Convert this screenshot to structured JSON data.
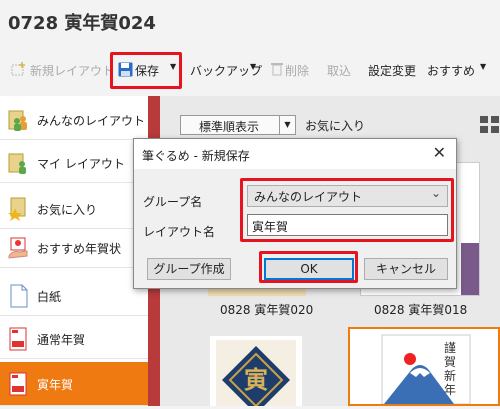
{
  "window": {
    "title": "0728 寅年賀024"
  },
  "toolbar": {
    "new_layout": "新規レイアウト",
    "save": "保存",
    "backup": "バックアップ",
    "delete": "削除",
    "import": "取込",
    "settings": "設定変更",
    "recommend": "おすすめ"
  },
  "sidebar": {
    "items": [
      {
        "label": "みんなのレイアウト",
        "icon": "folder-people-icon"
      },
      {
        "label": "マイ レイアウト",
        "icon": "folder-person-icon"
      },
      {
        "label": "お気に入り",
        "icon": "folder-star-icon"
      },
      {
        "label": "おすすめ年賀状",
        "icon": "card-hand-icon"
      },
      {
        "label": "白紙",
        "icon": "blank-page-icon"
      },
      {
        "label": "通常年賀",
        "icon": "red-card-icon"
      },
      {
        "label": "寅年賀",
        "icon": "red-card-icon",
        "selected": true
      }
    ]
  },
  "list": {
    "sort": "標準順表示",
    "favorites": "お気に入り",
    "cards": [
      {
        "caption": "0828 寅年賀020"
      },
      {
        "caption": "0828 寅年賀018"
      }
    ],
    "card3_text": "謹賀新年"
  },
  "dialog": {
    "title": "筆ぐるめ - 新規保存",
    "group_label": "グループ名",
    "group_value": "みんなのレイアウト",
    "layout_label": "レイアウト名",
    "layout_value": "寅年賀",
    "create_group": "グループ作成",
    "ok": "OK",
    "cancel": "キャンセル"
  },
  "colors": {
    "accent": "#ef7a12",
    "highlight": "#e5141e",
    "focus": "#0078d7"
  }
}
